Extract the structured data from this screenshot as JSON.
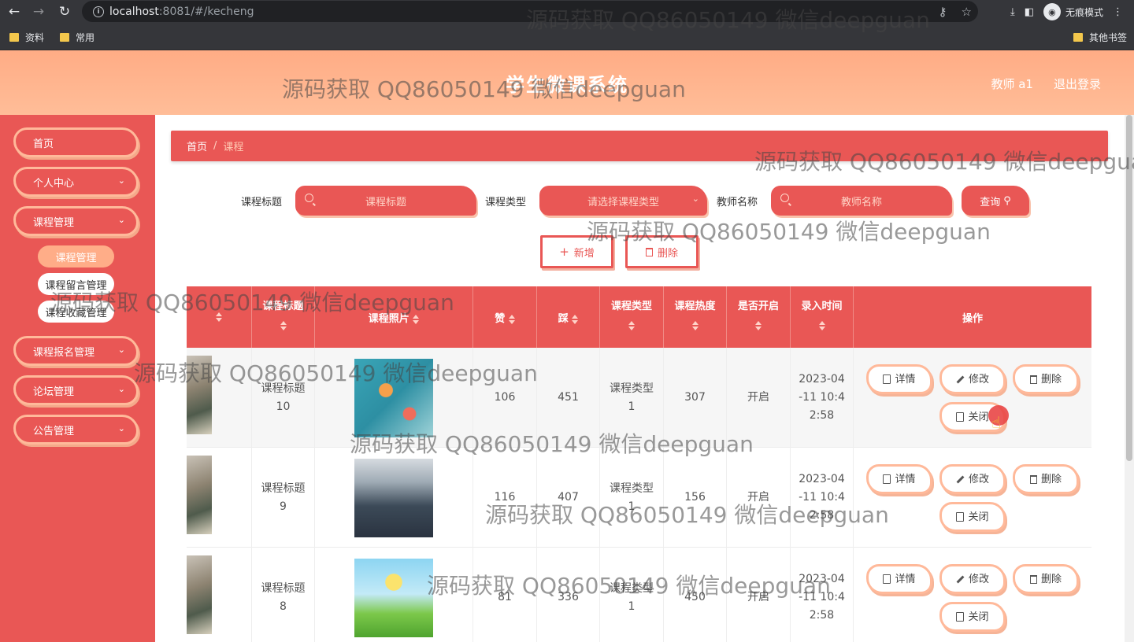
{
  "browser": {
    "url_host": "localhost",
    "url_rest": ":8081/#/kecheng",
    "incognito_label": "无痕模式",
    "bookmarks": [
      "资料",
      "常用"
    ],
    "other_bookmarks": "其他书签"
  },
  "header": {
    "title": "学生微课系统",
    "user": "教师 a1",
    "logout": "退出登录"
  },
  "sidebar": {
    "items": [
      {
        "label": "首页"
      },
      {
        "label": "个人中心"
      },
      {
        "label": "课程管理"
      },
      {
        "label": "课程报名管理"
      },
      {
        "label": "论坛管理"
      },
      {
        "label": "公告管理"
      }
    ],
    "sub_items": [
      {
        "label": "课程管理"
      },
      {
        "label": "课程留言管理"
      },
      {
        "label": "课程收藏管理"
      }
    ]
  },
  "breadcrumb": {
    "home": "首页",
    "sep": "/",
    "current": "课程"
  },
  "search": {
    "title_label": "课程标题",
    "title_placeholder": "课程标题",
    "type_label": "课程类型",
    "type_placeholder": "请选择课程类型",
    "teacher_label": "教师名称",
    "teacher_placeholder": "教师名称",
    "query_button": "查询"
  },
  "actions": {
    "add": "新增",
    "delete": "删除"
  },
  "table": {
    "headers": [
      "课程标题",
      "课程照片",
      "赞",
      "踩",
      "课程类型",
      "课程热度",
      "是否开启",
      "录入时间",
      "操作"
    ],
    "rows": [
      {
        "title": "课程标题\n10",
        "like": "106",
        "dislike": "451",
        "type": "课程类型\n1",
        "heat": "307",
        "open": "开启",
        "time": "2023-04\n-11 10:4\n2:58"
      },
      {
        "title": "课程标题\n9",
        "like": "116",
        "dislike": "407",
        "type": "课程类型\n1",
        "heat": "156",
        "open": "开启",
        "time": "2023-04\n-11 10:4\n2:58"
      },
      {
        "title": "课程标题\n8",
        "like": "81",
        "dislike": "336",
        "type": "课程类型\n1",
        "heat": "450",
        "open": "开启",
        "time": "2023-04\n-11 10:4\n2:58"
      }
    ],
    "ops": {
      "detail": "详情",
      "edit": "修改",
      "delete": "删除",
      "close": "关闭"
    }
  },
  "watermark": "源码获取 QQ86050149 微信deepguan",
  "colors": {
    "primary": "#e95755",
    "accent": "#ffac85",
    "border": "#ffb99a"
  }
}
